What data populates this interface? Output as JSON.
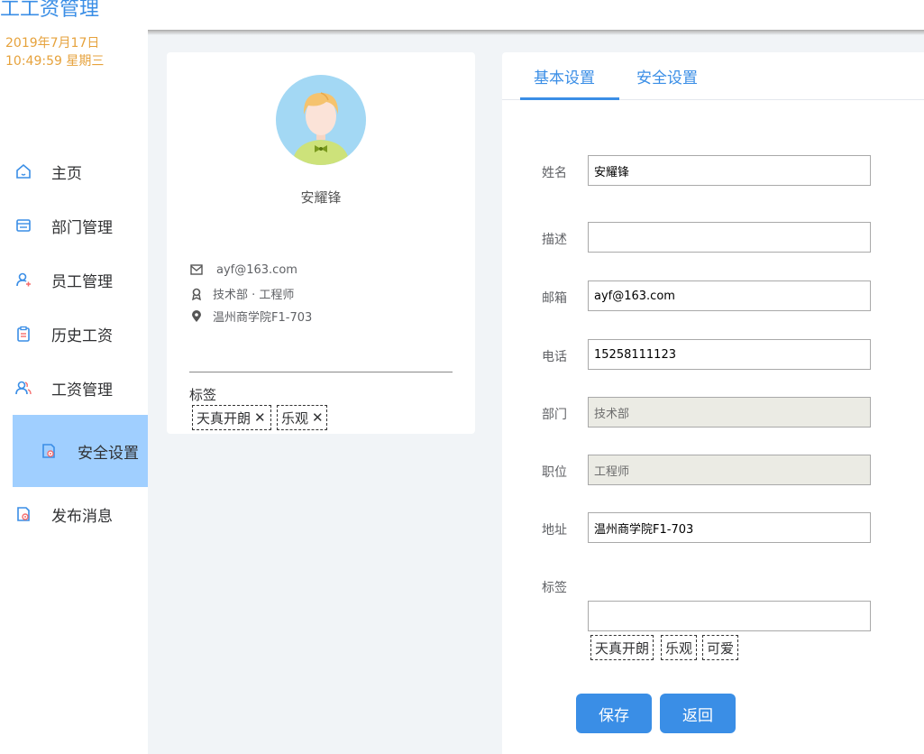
{
  "app": {
    "title": "员工工资管理",
    "date": "2019年7月17日",
    "time": "10:49:59 星期三"
  },
  "sidebar": {
    "items": [
      {
        "label": "主页",
        "icon": "home-icon"
      },
      {
        "label": "部门管理",
        "icon": "calendar-icon"
      },
      {
        "label": "员工管理",
        "icon": "user-add-icon"
      },
      {
        "label": "历史工资",
        "icon": "clipboard-icon"
      },
      {
        "label": "工资管理",
        "icon": "users-icon"
      },
      {
        "label": "安全设置",
        "icon": "document-settings-icon"
      },
      {
        "label": "发布消息",
        "icon": "document-settings-icon"
      }
    ],
    "active_color": "#a0cfff"
  },
  "profile": {
    "name": "安耀锋",
    "email": "ayf@163.com",
    "position": "技术部 · 工程师",
    "address": "温州商学院F1-703",
    "tags_title": "标签",
    "tags": [
      "天真开朗",
      "乐观"
    ]
  },
  "settings": {
    "tabs": [
      "基本设置",
      "安全设置"
    ],
    "active_tab": "基本设置",
    "fields": {
      "name": {
        "label": "姓名",
        "value": "安耀锋"
      },
      "desc": {
        "label": "描述",
        "value": ""
      },
      "email": {
        "label": "邮箱",
        "value": "ayf@163.com"
      },
      "phone": {
        "label": "电话",
        "value": "15258111123"
      },
      "department": {
        "label": "部门",
        "value": "技术部"
      },
      "position": {
        "label": "职位",
        "value": "工程师"
      },
      "address": {
        "label": "地址",
        "value": "温州商学院F1-703"
      },
      "tags": {
        "label": "标签",
        "value": ""
      }
    },
    "tags": [
      "天真开朗",
      "乐观",
      "可爱"
    ],
    "save_label": "保存",
    "back_label": "返回"
  },
  "colors": {
    "accent": "#3a8ee6",
    "clock": "#e6a23c"
  }
}
